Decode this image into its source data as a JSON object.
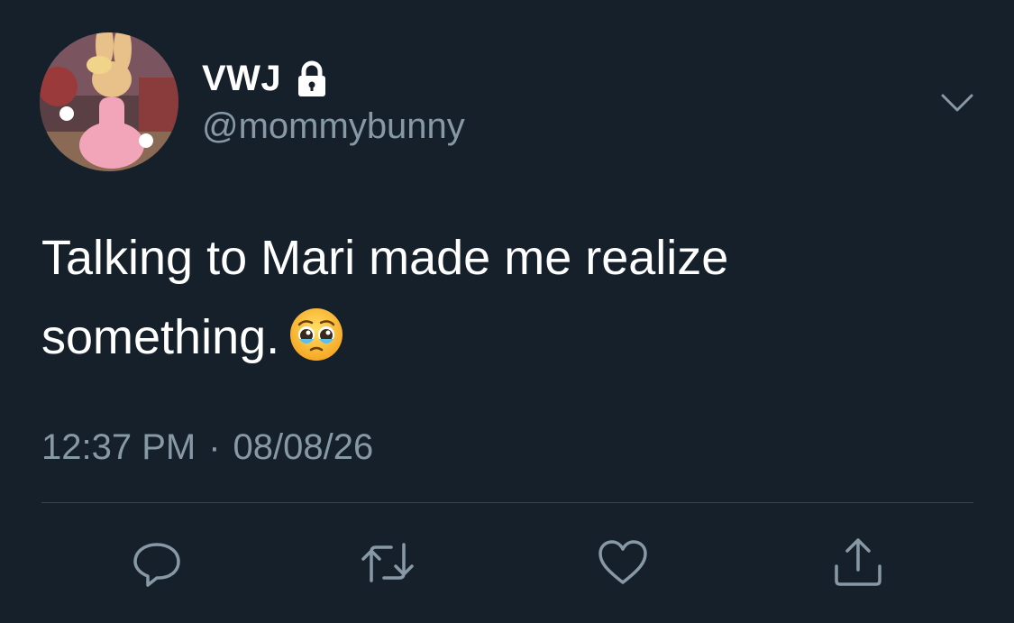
{
  "tweet": {
    "display_name": "VWJ",
    "handle": "@mommybunny",
    "text_line1": "Talking to Mari made me realize",
    "text_line2": "something.",
    "emoji": "pleading-face-with-tears-emoji",
    "time": "12:37 PM",
    "separator": "·",
    "date": "08/08/26",
    "protected": true
  },
  "icons": {
    "lock": "lock-icon",
    "caret": "chevron-down-icon",
    "reply": "reply-icon",
    "retweet": "retweet-icon",
    "like": "heart-icon",
    "share": "share-icon"
  },
  "colors": {
    "background": "#15202b",
    "primary_text": "#ffffff",
    "secondary_text": "#8899a6",
    "divider": "#38444d"
  }
}
